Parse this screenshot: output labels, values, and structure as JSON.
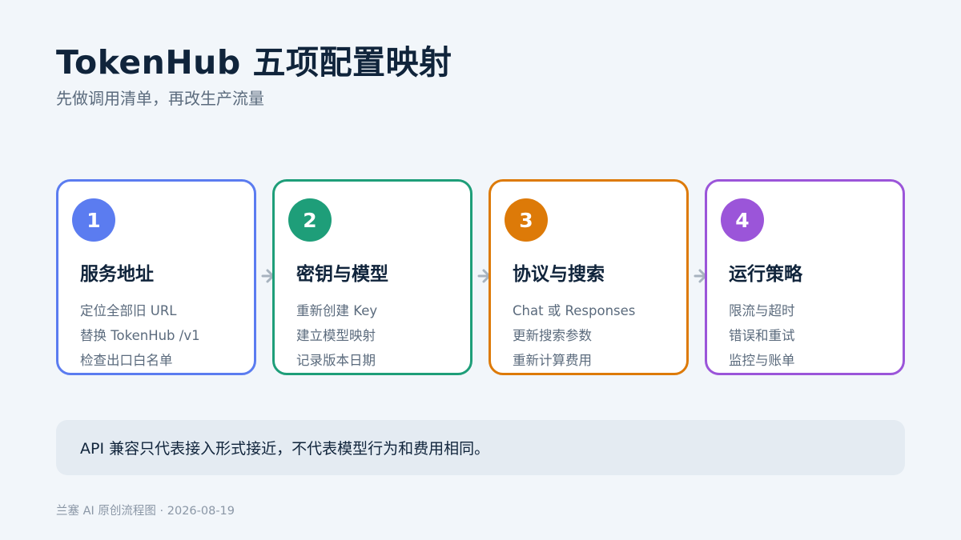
{
  "title": "TokenHub 五项配置映射",
  "subtitle": "先做调用清单，再改生产流量",
  "colors": {
    "step1": "#5b7cf0",
    "step2": "#1e9e79",
    "step3": "#dd7a08",
    "step4": "#9b55d9",
    "arrow": "#a7b3bf"
  },
  "steps": [
    {
      "number": "1",
      "title": "服务地址",
      "lines": [
        "定位全部旧 URL",
        "替换 TokenHub /v1",
        "检查出口白名单"
      ]
    },
    {
      "number": "2",
      "title": "密钥与模型",
      "lines": [
        "重新创建 Key",
        "建立模型映射",
        "记录版本日期"
      ]
    },
    {
      "number": "3",
      "title": "协议与搜索",
      "lines": [
        "Chat 或 Responses",
        "更新搜索参数",
        "重新计算费用"
      ]
    },
    {
      "number": "4",
      "title": "运行策略",
      "lines": [
        "限流与超时",
        "错误和重试",
        "监控与账单"
      ]
    }
  ],
  "note": "API 兼容只代表接入形式接近，不代表模型行为和费用相同。",
  "footer": "兰塞 AI 原创流程图 · 2026-08-19"
}
